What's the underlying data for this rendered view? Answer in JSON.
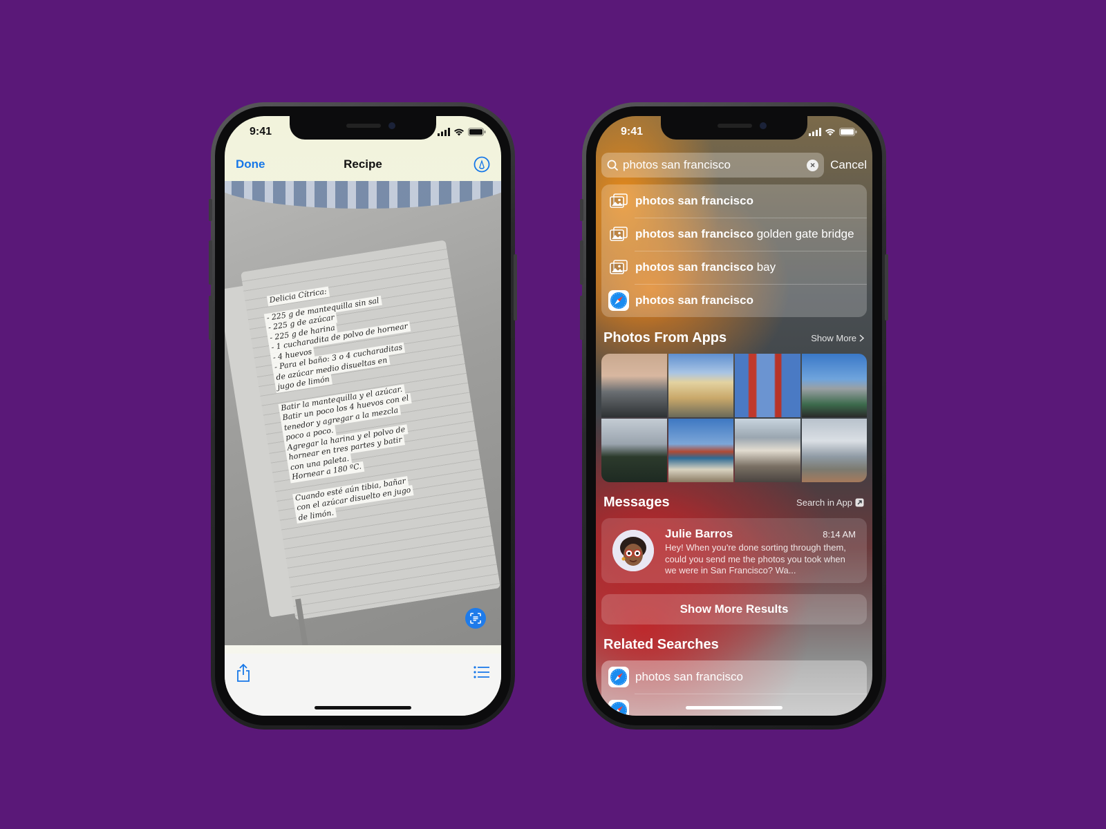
{
  "left_phone": {
    "status": {
      "time": "9:41"
    },
    "nav": {
      "done_label": "Done",
      "title": "Recipe"
    },
    "recipe_lines": [
      "Delicia Cítrica:",
      "- 225 g de mantequilla sin sal",
      "- 225 g de azúcar",
      "- 225 g de harina",
      "- 1 cucharadita de polvo de hornear",
      "- 4 huevos",
      "- Para el baño: 3 o 4 cucharaditas",
      "de azúcar medio disueltas en",
      "jugo de limón",
      "",
      "Batir la mantequilla y el azúcar.",
      "Batir un poco los 4 huevos con el",
      "tenedor y agregar a la mezcla",
      "poco a poco.",
      "Agregar la harina y el polvo de",
      "hornear en tres partes y batir",
      "con una paleta.",
      "Hornear a 180 ºC.",
      "",
      "Cuando esté aún tibia, bañar",
      "con el azúcar disuelto en jugo",
      "de limón."
    ]
  },
  "right_phone": {
    "status": {
      "time": "9:41"
    },
    "search": {
      "query": "photos san francisco",
      "cancel_label": "Cancel"
    },
    "suggestions": [
      {
        "icon": "photos-icon",
        "bold": "photos san francisco",
        "rest": ""
      },
      {
        "icon": "photos-icon",
        "bold": "photos san francisco",
        "rest": " golden gate bridge"
      },
      {
        "icon": "photos-icon",
        "bold": "photos san francisco",
        "rest": " bay"
      },
      {
        "icon": "safari-icon",
        "bold": "photos san francisco",
        "rest": ""
      }
    ],
    "photos_section": {
      "title": "Photos From Apps",
      "link": "Show More"
    },
    "messages_section": {
      "title": "Messages",
      "link": "Search in App"
    },
    "message": {
      "name": "Julie Barros",
      "time": "8:14 AM",
      "body": "Hey! When you're done sorting through them, could you send me the photos you took when we were in San Francisco? Wa..."
    },
    "show_more_label": "Show More Results",
    "related_section": {
      "title": "Related Searches"
    },
    "related": [
      {
        "icon": "safari-icon",
        "text": "photos san francisco"
      }
    ]
  },
  "colors": {
    "background": "#5a1878",
    "ios_blue": "#1677e8"
  }
}
